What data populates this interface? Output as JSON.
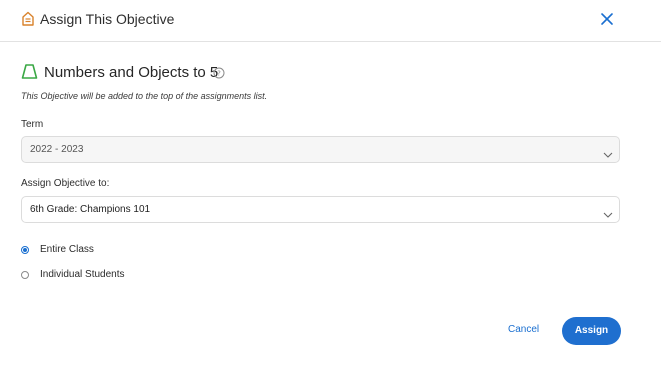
{
  "header": {
    "title": "Assign This Objective",
    "icon": "assignment-icon",
    "close_icon": "close-icon",
    "accent_color": "#d9822b"
  },
  "objective": {
    "title": "Numbers and Objects to 5",
    "icon": "trapezoid-icon",
    "icon_color": "#3aa845",
    "help_icon": "help-icon",
    "note": "This Objective will be added to the top of the assignments list."
  },
  "term": {
    "label": "Term",
    "value": "2022 - 2023"
  },
  "assign_to": {
    "label": "Assign Objective to:",
    "value": "6th Grade: Champions 101"
  },
  "options": [
    {
      "label": "Entire Class",
      "checked": true
    },
    {
      "label": "Individual Students",
      "checked": false
    }
  ],
  "actions": {
    "cancel_label": "Cancel",
    "assign_label": "Assign",
    "primary_color": "#1f6fcf"
  }
}
